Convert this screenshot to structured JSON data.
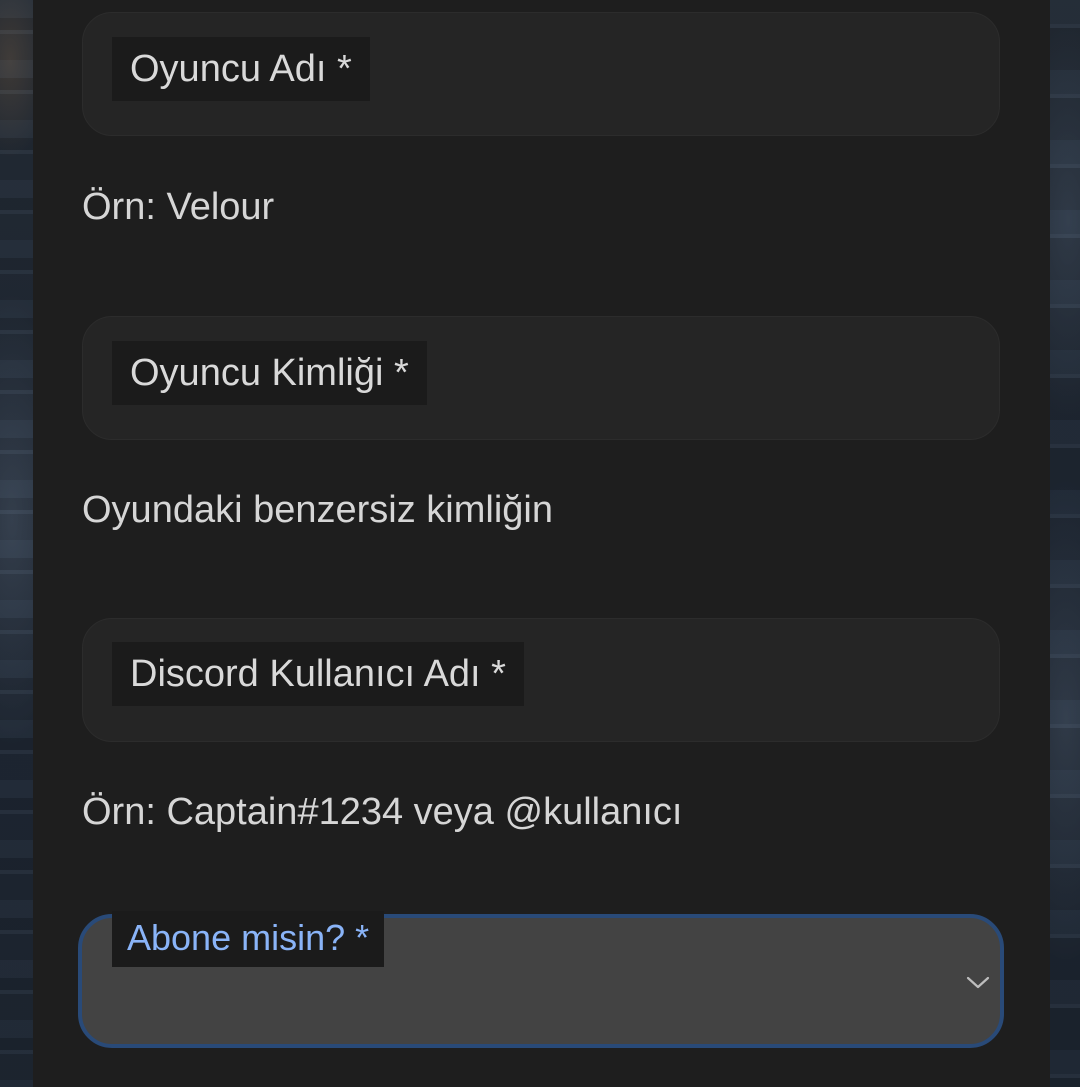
{
  "form": {
    "fields": [
      {
        "label": "Oyuncu Adı *",
        "helper": "Örn: Velour"
      },
      {
        "label": "Oyuncu Kimliği *",
        "helper": "Oyundaki benzersiz kimliğin"
      },
      {
        "label": "Discord Kullanıcı Adı *",
        "helper": "Örn: Captain#1234 veya @kullanıcı"
      }
    ],
    "subscribe_select": {
      "label": "Abone misin? *",
      "icon": "chevron-down-icon",
      "focused": true
    }
  },
  "colors": {
    "panel": "#1e1e1e",
    "field": "#252525",
    "select_fill": "#434343",
    "focus_border": "#294a78",
    "focus_label": "#8ab4f8",
    "text": "#d9d9d9"
  }
}
